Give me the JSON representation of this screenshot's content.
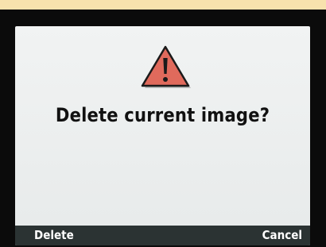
{
  "dialog": {
    "prompt": "Delete current image?",
    "icon": "warning-triangle-icon"
  },
  "softkeys": {
    "left_label": "Delete",
    "right_label": "Cancel"
  },
  "colors": {
    "background": "#f7e2ad",
    "bezel": "#0b0b0b",
    "screen": "#eceeee",
    "warning_fill": "#e06a5c",
    "softkey_bar": "#2b3333"
  }
}
